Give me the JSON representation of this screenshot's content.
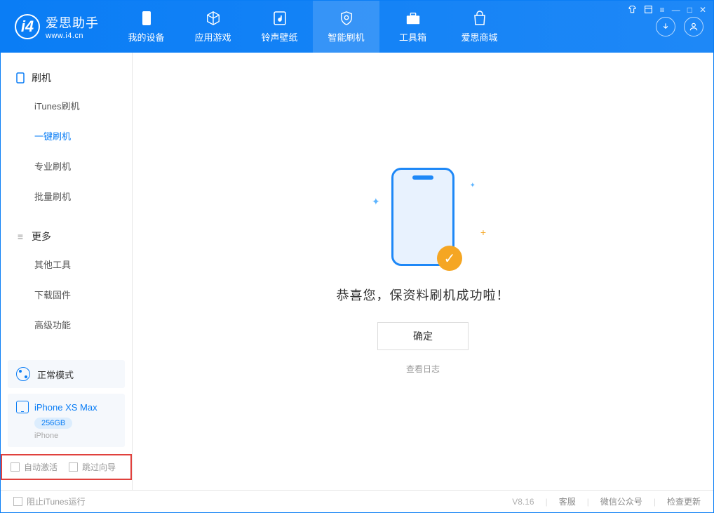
{
  "app": {
    "name": "爱思助手",
    "url": "www.i4.cn"
  },
  "nav": {
    "tabs": [
      {
        "label": "我的设备"
      },
      {
        "label": "应用游戏"
      },
      {
        "label": "铃声壁纸"
      },
      {
        "label": "智能刷机"
      },
      {
        "label": "工具箱"
      },
      {
        "label": "爱思商城"
      }
    ]
  },
  "sidebar": {
    "sections": [
      {
        "title": "刷机",
        "items": [
          {
            "label": "iTunes刷机"
          },
          {
            "label": "一键刷机"
          },
          {
            "label": "专业刷机"
          },
          {
            "label": "批量刷机"
          }
        ]
      },
      {
        "title": "更多",
        "items": [
          {
            "label": "其他工具"
          },
          {
            "label": "下载固件"
          },
          {
            "label": "高级功能"
          }
        ]
      }
    ],
    "status": "正常模式",
    "device": {
      "name": "iPhone XS Max",
      "capacity": "256GB",
      "type": "iPhone"
    },
    "options": {
      "auto_activate": "自动激活",
      "skip_guide": "跳过向导"
    }
  },
  "main": {
    "message": "恭喜您，保资料刷机成功啦！",
    "ok_button": "确定",
    "log_link": "查看日志"
  },
  "footer": {
    "block_itunes": "阻止iTunes运行",
    "version": "V8.16",
    "links": {
      "support": "客服",
      "wechat": "微信公众号",
      "update": "检查更新"
    }
  }
}
